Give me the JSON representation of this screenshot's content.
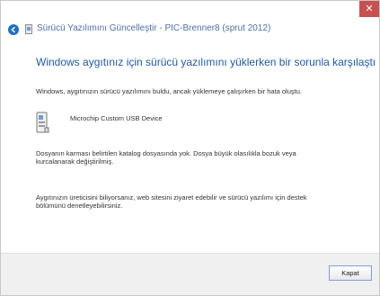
{
  "window": {
    "close_glyph": "✕"
  },
  "header": {
    "title": "Sürücü Yazılımını Güncelleştir - PIC-Brenner8 (sprut 2012)"
  },
  "main": {
    "heading": "Windows aygıtınız için sürücü yazılımını yüklerken bir sorunla karşılaştı",
    "status_text": "Windows, aygıtınızın sürücü yazılımını buldu, ancak yüklemeye çalışırken bir hata oluştu.",
    "device_name": "Microchip Custom USB Device",
    "error_line1": "Dosyanın karması belirtilen katalog dosyasında yok. Dosya büyük olasılıkla bozuk veya",
    "error_line2": "kurcalanarak değiştirilmiş.",
    "help_line1": "Aygıtınızın üreticisini biliyorsanız, web sitesini ziyaret edebilir ve sürücü yazılımı için destek",
    "help_line2": "bölümünü denetleyebilirsiniz."
  },
  "footer": {
    "close_label": "Kapat"
  },
  "colors": {
    "accent_blue": "#1e5aa8",
    "close_red": "#c75050"
  },
  "icons": {
    "back": "back-arrow-icon",
    "device": "usb-device-icon"
  }
}
